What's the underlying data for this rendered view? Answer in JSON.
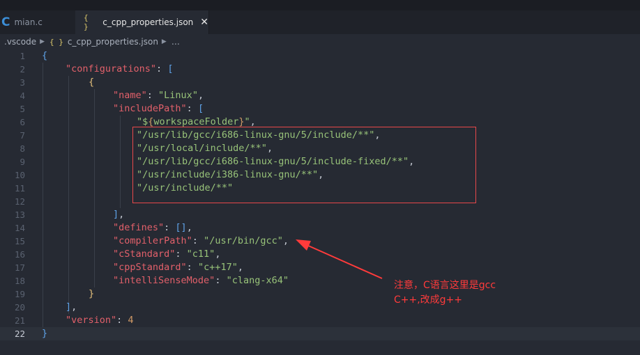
{
  "tabs": [
    {
      "icon": "C",
      "label": "mian.c"
    },
    {
      "icon": "{ }",
      "label": "c_cpp_properties.json",
      "close": "✕"
    }
  ],
  "breadcrumb": {
    "folder": ".vscode",
    "brace": "{ }",
    "file": "c_cpp_properties.json",
    "more": "…"
  },
  "gutter": [
    "1",
    "2",
    "3",
    "4",
    "5",
    "6",
    "7",
    "8",
    "9",
    "10",
    "11",
    "12",
    "13",
    "14",
    "15",
    "16",
    "17",
    "18",
    "19",
    "20",
    "21",
    "22"
  ],
  "code": {
    "l1_open": "{",
    "l2_key": "\"configurations\"",
    "l2_colon": ": ",
    "l2_br": "[",
    "l3_open": "{",
    "l4_key": "\"name\"",
    "l4_colon": ": ",
    "l4_val": "\"Linux\"",
    "l4_comma": ",",
    "l5_key": "\"includePath\"",
    "l5_colon": ": ",
    "l5_br": "[",
    "l6_q1": "\"$",
    "l6_ob": "{",
    "l6_var": "workspaceFolder",
    "l6_cb": "}",
    "l6_q2": "\"",
    "l6_comma": ",",
    "l7_val": "\"/usr/lib/gcc/i686-linux-gnu/5/include/**\"",
    "l7_comma": ",",
    "l8_val": "\"/usr/local/include/**\"",
    "l8_comma": ",",
    "l9_val": "\"/usr/lib/gcc/i686-linux-gnu/5/include-fixed/**\"",
    "l9_comma": ",",
    "l10_val": "\"/usr/include/i386-linux-gnu/**\"",
    "l10_comma": ",",
    "l11_val": "\"/usr/include/**\"",
    "l13_br": "]",
    "l13_comma": ",",
    "l14_key": "\"defines\"",
    "l14_colon": ": ",
    "l14_val": "[]",
    "l14_comma": ",",
    "l15_key": "\"compilerPath\"",
    "l15_colon": ": ",
    "l15_val": "\"/usr/bin/gcc\"",
    "l15_comma": ",",
    "l16_key": "\"cStandard\"",
    "l16_colon": ": ",
    "l16_val": "\"c11\"",
    "l16_comma": ",",
    "l17_key": "\"cppStandard\"",
    "l17_colon": ": ",
    "l17_val": "\"c++17\"",
    "l17_comma": ",",
    "l18_key": "\"intelliSenseMode\"",
    "l18_colon": ": ",
    "l18_val": "\"clang-x64\"",
    "l19_close": "}",
    "l20_br": "]",
    "l20_comma": ",",
    "l21_key": "\"version\"",
    "l21_colon": ": ",
    "l21_val": "4",
    "l22_close": "}"
  },
  "annotation": {
    "line1": "注意，C语言这里是gcc",
    "line2": "C++,改成g++"
  },
  "colors": {
    "annotation": "#ff3b3b",
    "key": "#e2606a",
    "string": "#98c379",
    "number": "#d19a66",
    "bracket": "#5fa3e8"
  }
}
